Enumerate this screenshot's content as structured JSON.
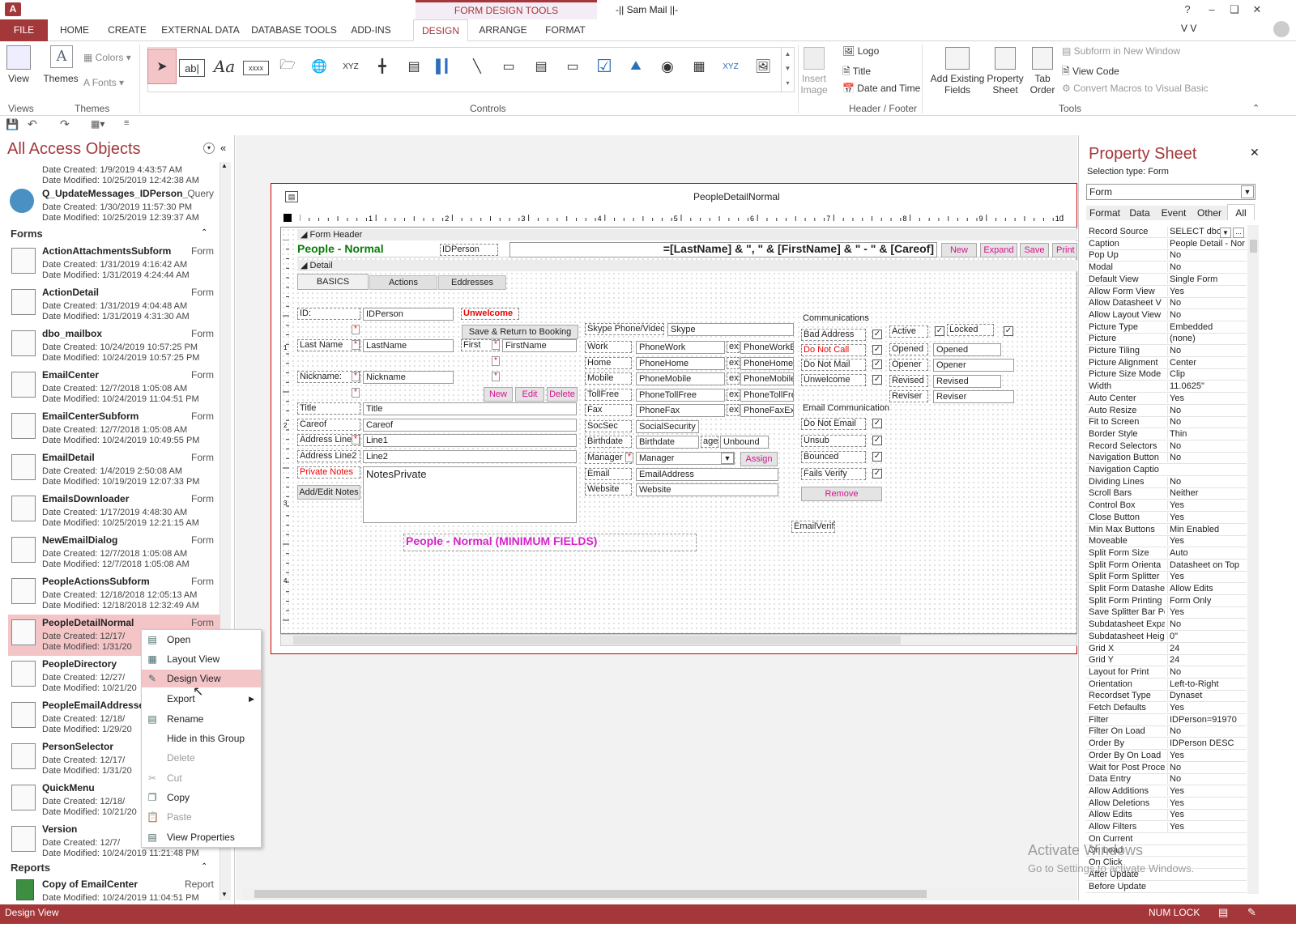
{
  "window": {
    "title": "-|| Sam Mail ||-",
    "contextual_tab": "FORM DESIGN TOOLS",
    "user": "V V",
    "help": "?"
  },
  "tabs": {
    "file": "FILE",
    "home": "HOME",
    "create": "CREATE",
    "external": "EXTERNAL DATA",
    "dbtools": "DATABASE TOOLS",
    "addins": "ADD-INS",
    "design": "DESIGN",
    "arrange": "ARRANGE",
    "format": "FORMAT"
  },
  "ribbon": {
    "view": "View",
    "themes": "Themes",
    "colors": "Colors",
    "fonts": "Fonts",
    "insert_image": "Insert Image",
    "logo": "Logo",
    "title": "Title",
    "date_time": "Date and Time",
    "add_fields": "Add Existing Fields",
    "property_sheet": "Property Sheet",
    "tab_order": "Tab Order",
    "subform_new": "Subform in New Window",
    "view_code": "View Code",
    "convert_macros": "Convert Macros to Visual Basic",
    "groups": {
      "views": "Views",
      "themes": "Themes",
      "controls": "Controls",
      "header_footer": "Header / Footer",
      "tools": "Tools"
    }
  },
  "nav": {
    "title": "All Access Objects",
    "top_item": {
      "d1": "Date Created: 1/9/2019 4:43:57 AM",
      "d2": "Date Modified: 10/25/2019 12:42:38 AM"
    },
    "query": {
      "name": "Q_UpdateMessages_IDPerson_Se...",
      "type": "Query",
      "d1": "Date Created: 1/30/2019 11:57:30 PM",
      "d2": "Date Modified: 10/25/2019 12:39:37 AM"
    },
    "forms_header": "Forms",
    "forms": [
      {
        "name": "ActionAttachmentsSubform",
        "type": "Form",
        "d1": "Date Created: 1/31/2019 4:16:42 AM",
        "d2": "Date Modified: 1/31/2019 4:24:44 AM"
      },
      {
        "name": "ActionDetail",
        "type": "Form",
        "d1": "Date Created: 1/31/2019 4:04:48 AM",
        "d2": "Date Modified: 1/31/2019 4:31:30 AM"
      },
      {
        "name": "dbo_mailbox",
        "type": "Form",
        "d1": "Date Created: 10/24/2019 10:57:25 PM",
        "d2": "Date Modified: 10/24/2019 10:57:25 PM"
      },
      {
        "name": "EmailCenter",
        "type": "Form",
        "d1": "Date Created: 12/7/2018 1:05:08 AM",
        "d2": "Date Modified: 10/24/2019 11:04:51 PM"
      },
      {
        "name": "EmailCenterSubform",
        "type": "Form",
        "d1": "Date Created: 12/7/2018 1:05:08 AM",
        "d2": "Date Modified: 10/24/2019 10:49:55 PM"
      },
      {
        "name": "EmailDetail",
        "type": "Form",
        "d1": "Date Created: 1/4/2019 2:50:08 AM",
        "d2": "Date Modified: 10/19/2019 12:07:33 PM"
      },
      {
        "name": "EmailsDownloader",
        "type": "Form",
        "d1": "Date Created: 1/17/2019 4:48:30 AM",
        "d2": "Date Modified: 10/25/2019 12:21:15 AM"
      },
      {
        "name": "NewEmailDialog",
        "type": "Form",
        "d1": "Date Created: 12/7/2018 1:05:08 AM",
        "d2": "Date Modified: 12/7/2018 1:05:08 AM"
      },
      {
        "name": "PeopleActionsSubform",
        "type": "Form",
        "d1": "Date Created: 12/18/2018 12:05:13 AM",
        "d2": "Date Modified: 12/18/2018 12:32:49 AM"
      },
      {
        "name": "PeopleDetailNormal",
        "type": "Form",
        "d1": "Date Created: 12/17/",
        "d2": "Date Modified: 1/31/20"
      },
      {
        "name": "PeopleDirectory",
        "type": "",
        "d1": "Date Created: 12/27/",
        "d2": "Date Modified: 10/21/20"
      },
      {
        "name": "PeopleEmailAddressesS",
        "type": "",
        "d1": "Date Created: 12/18/",
        "d2": "Date Modified: 1/29/20"
      },
      {
        "name": "PersonSelector",
        "type": "",
        "d1": "Date Created: 12/17/",
        "d2": "Date Modified: 1/31/20"
      },
      {
        "name": "QuickMenu",
        "type": "",
        "d1": "Date Created: 12/18/",
        "d2": "Date Modified: 10/21/20"
      },
      {
        "name": "Version",
        "type": "",
        "d1": "Date Created: 12/7/",
        "d2": "Date Modified: 10/24/2019 11:21:48 PM"
      }
    ],
    "reports_header": "Reports",
    "report": {
      "name": "Copy of EmailCenter",
      "type": "Report",
      "d1": "Date Modified: 10/24/2019 11:04:51 PM"
    }
  },
  "context_menu": {
    "open": "Open",
    "layout_view": "Layout View",
    "design_view": "Design View",
    "export": "Export",
    "rename": "Rename",
    "hide": "Hide in this Group",
    "delete": "Delete",
    "cut": "Cut",
    "copy": "Copy",
    "paste": "Paste",
    "view_props": "View Properties"
  },
  "form": {
    "title": "PeopleDetailNormal",
    "ruler": [
      "1",
      "2",
      "3",
      "4",
      "5",
      "6",
      "7",
      "8",
      "9",
      "10"
    ],
    "vruler": [
      "1",
      "2",
      "3",
      "4"
    ],
    "form_header": "Form Header",
    "detail": "Detail",
    "header_label": "People - Normal",
    "header_id": "IDPerson",
    "header_expr": "=[LastName] & \", \" & [FirstName] & \" - \" & [Careof]",
    "header_buttons": [
      "New",
      "Expand",
      "Save",
      "Print"
    ],
    "tabs": [
      "BASICS",
      "Actions",
      "Eddresses"
    ],
    "id_label": "ID:",
    "id_field": "IDPerson",
    "unwelcome_label": "Unwelcome",
    "save_return": "Save & Return to Booking",
    "lastname_label": "Last Name",
    "lastname_field": "LastName",
    "first_label": "First",
    "firstname_field": "FirstName",
    "nickname_label": "Nickname:",
    "nickname_field": "Nickname",
    "new_btn": "New",
    "edit_btn": "Edit",
    "delete_btn": "Delete",
    "title_label": "Title",
    "title_field": "Title",
    "careof_label": "Careof",
    "careof_field": "Careof",
    "addr1_label": "Address Line1",
    "addr1_field": "Line1",
    "addr2_label": "Address Line2",
    "addr2_field": "Line2",
    "notes_label": "Private Notes",
    "notes_field": "NotesPrivate",
    "add_edit_notes": "Add/Edit Notes",
    "skype_label": "Skype Phone/Video",
    "skype_field": "Skype",
    "phones": [
      {
        "label": "Work",
        "field": "PhoneWork",
        "ext": "ext",
        "extfield": "PhoneWorkE"
      },
      {
        "label": "Home",
        "field": "PhoneHome",
        "ext": "ext",
        "extfield": "PhoneHomeE"
      },
      {
        "label": "Mobile",
        "field": "PhoneMobile",
        "ext": "ext",
        "extfield": "PhoneMobileE"
      },
      {
        "label": "TollFree",
        "field": "PhoneTollFree",
        "ext": "ext",
        "extfield": "PhoneTollFre"
      },
      {
        "label": "Fax",
        "field": "PhoneFax",
        "ext": "ext",
        "extfield": "PhoneFaxExt"
      }
    ],
    "socsec_label": "SocSec",
    "socsec_field": "SocialSecurity",
    "birthdate_label": "Birthdate",
    "birthdate_field": "Birthdate",
    "age_label": "age",
    "age_field": "Unbound",
    "manager_label": "Manager",
    "manager_field": "Manager",
    "assign_btn": "Assign",
    "email_label": "Email",
    "email_field": "EmailAddress",
    "website_label": "Website",
    "website_field": "Website",
    "comm_label": "Communications",
    "comm": [
      "Bad Address",
      "Do Not Call",
      "Do Not Mail",
      "Unwelcome"
    ],
    "status": [
      {
        "label": "Active",
        "field": "",
        "chk2": "Locked"
      },
      {
        "label": "Opened",
        "field": "Opened"
      },
      {
        "label": "Opener",
        "field": "Opener"
      },
      {
        "label": "Revised",
        "field": "Revised"
      },
      {
        "label": "Reviser",
        "field": "Reviser"
      }
    ],
    "email_comm_label": "Email Communication",
    "email_comm": [
      "Do Not Email",
      "Unsub",
      "Bounced",
      "Fails Verify"
    ],
    "remove_btn": "Remove",
    "email_verifi": "EmailVerifi",
    "min_label": "People - Normal  (MINIMUM  FIELDS)"
  },
  "property_sheet": {
    "title": "Property Sheet",
    "selection_label": "Selection type:  Form",
    "selector": "Form",
    "tabs": [
      "Format",
      "Data",
      "Event",
      "Other",
      "All"
    ],
    "rows": [
      [
        "Record Source",
        "SELECT dbo_"
      ],
      [
        "Caption",
        "People Detail - Nor"
      ],
      [
        "Pop Up",
        "No"
      ],
      [
        "Modal",
        "No"
      ],
      [
        "Default View",
        "Single Form"
      ],
      [
        "Allow Form View",
        "Yes"
      ],
      [
        "Allow Datasheet V",
        "No"
      ],
      [
        "Allow Layout View",
        "No"
      ],
      [
        "Picture Type",
        "Embedded"
      ],
      [
        "Picture",
        "(none)"
      ],
      [
        "Picture Tiling",
        "No"
      ],
      [
        "Picture Alignment",
        "Center"
      ],
      [
        "Picture Size Mode",
        "Clip"
      ],
      [
        "Width",
        "11.0625\""
      ],
      [
        "Auto Center",
        "Yes"
      ],
      [
        "Auto Resize",
        "No"
      ],
      [
        "Fit to Screen",
        "No"
      ],
      [
        "Border Style",
        "Thin"
      ],
      [
        "Record Selectors",
        "No"
      ],
      [
        "Navigation Button",
        "No"
      ],
      [
        "Navigation Captio",
        ""
      ],
      [
        "Dividing Lines",
        "No"
      ],
      [
        "Scroll Bars",
        "Neither"
      ],
      [
        "Control Box",
        "Yes"
      ],
      [
        "Close Button",
        "Yes"
      ],
      [
        "Min Max Buttons",
        "Min Enabled"
      ],
      [
        "Moveable",
        "Yes"
      ],
      [
        "Split Form Size",
        "Auto"
      ],
      [
        "Split Form Orienta",
        "Datasheet on Top"
      ],
      [
        "Split Form Splitter",
        "Yes"
      ],
      [
        "Split Form Datashe",
        "Allow Edits"
      ],
      [
        "Split Form Printing",
        "Form Only"
      ],
      [
        "Save Splitter Bar Pc",
        "Yes"
      ],
      [
        "Subdatasheet Expa",
        "No"
      ],
      [
        "Subdatasheet Heig",
        "0\""
      ],
      [
        "Grid X",
        "24"
      ],
      [
        "Grid Y",
        "24"
      ],
      [
        "Layout for Print",
        "No"
      ],
      [
        "Orientation",
        "Left-to-Right"
      ],
      [
        "Recordset Type",
        "Dynaset"
      ],
      [
        "Fetch Defaults",
        "Yes"
      ],
      [
        "Filter",
        "IDPerson=91970"
      ],
      [
        "Filter On Load",
        "No"
      ],
      [
        "Order By",
        "IDPerson DESC"
      ],
      [
        "Order By On Load",
        "Yes"
      ],
      [
        "Wait for Post Proce",
        "No"
      ],
      [
        "Data Entry",
        "No"
      ],
      [
        "Allow Additions",
        "Yes"
      ],
      [
        "Allow Deletions",
        "Yes"
      ],
      [
        "Allow Edits",
        "Yes"
      ],
      [
        "Allow Filters",
        "Yes"
      ],
      [
        "On Current",
        ""
      ],
      [
        "On Load",
        ""
      ],
      [
        "On Click",
        ""
      ],
      [
        "After Update",
        ""
      ],
      [
        "Before Update",
        ""
      ]
    ]
  },
  "watermark": {
    "line1": "Activate Windows",
    "line2": "Go to Settings to activate Windows."
  },
  "status": {
    "left": "Design View",
    "numlock": "NUM LOCK"
  },
  "colors": {
    "accent": "#a4373a",
    "highlight": "#f4c5c7"
  }
}
